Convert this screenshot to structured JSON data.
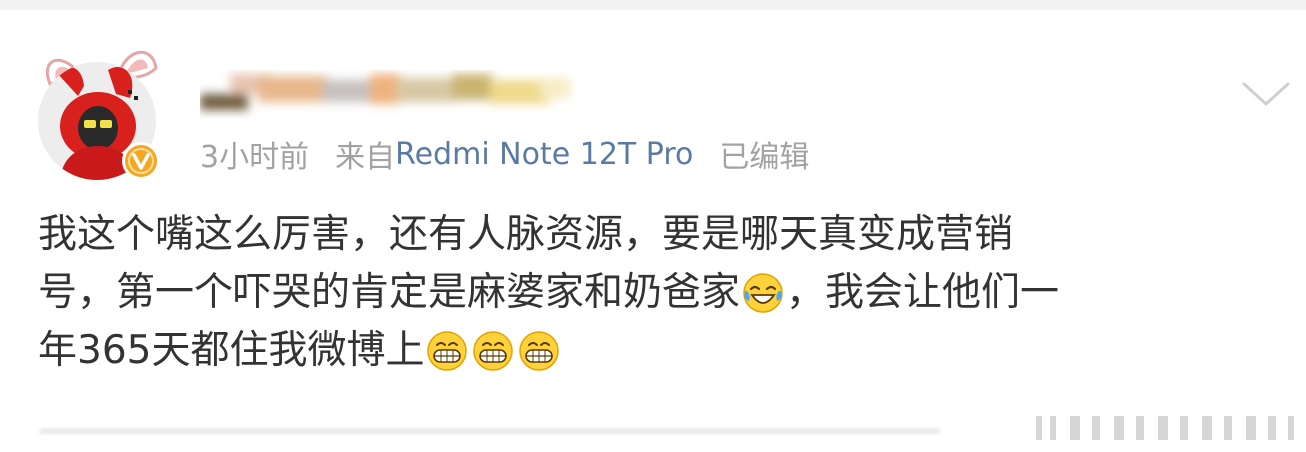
{
  "post": {
    "meta": {
      "time": "3小时前",
      "source_prefix": "来自",
      "device": "Redmi Note 12T Pro",
      "edited": "已编辑"
    },
    "content": {
      "line1": "我这个嘴这么厉害，还有人脉资源，要是哪天真变成营销",
      "line2_a": "号，第一个吓哭的肯定是麻婆家和奶爸家",
      "line2_b": "，我会让他们一",
      "line3": "年365天都住我微博上"
    },
    "icons": {
      "more": "chevron-down-icon",
      "verified": "verified-v-badge-icon",
      "emoji_tears": "laughing-tears-emoji-icon",
      "emoji_grin": "grin-emoji-icon"
    },
    "colors": {
      "meta_text": "#a2a2a2",
      "device_link": "#5b7aa3",
      "body_text": "#333333",
      "badge": "#f5a623"
    }
  }
}
